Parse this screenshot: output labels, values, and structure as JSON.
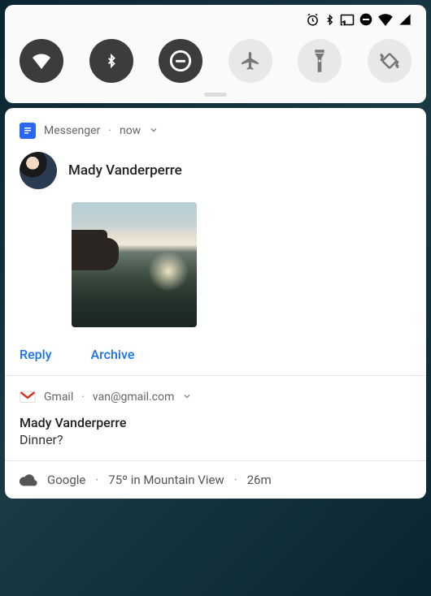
{
  "quick_settings": {
    "tiles": {
      "wifi": "wifi",
      "bluetooth": "bluetooth",
      "dnd": "do-not-disturb",
      "airplane": "airplane",
      "flashlight": "flashlight",
      "rotate": "auto-rotate"
    }
  },
  "notifications": {
    "messenger": {
      "app_name": "Messenger",
      "time": "now",
      "sender": "Mady Vanderperre",
      "actions": {
        "reply": "Reply",
        "archive": "Archive"
      }
    },
    "gmail": {
      "app_name": "Gmail",
      "account": "van@gmail.com",
      "sender": "Mady Vanderperre",
      "subject": "Dinner?"
    },
    "weather": {
      "source": "Google",
      "summary": "75º in Mountain View",
      "time": "26m"
    }
  }
}
